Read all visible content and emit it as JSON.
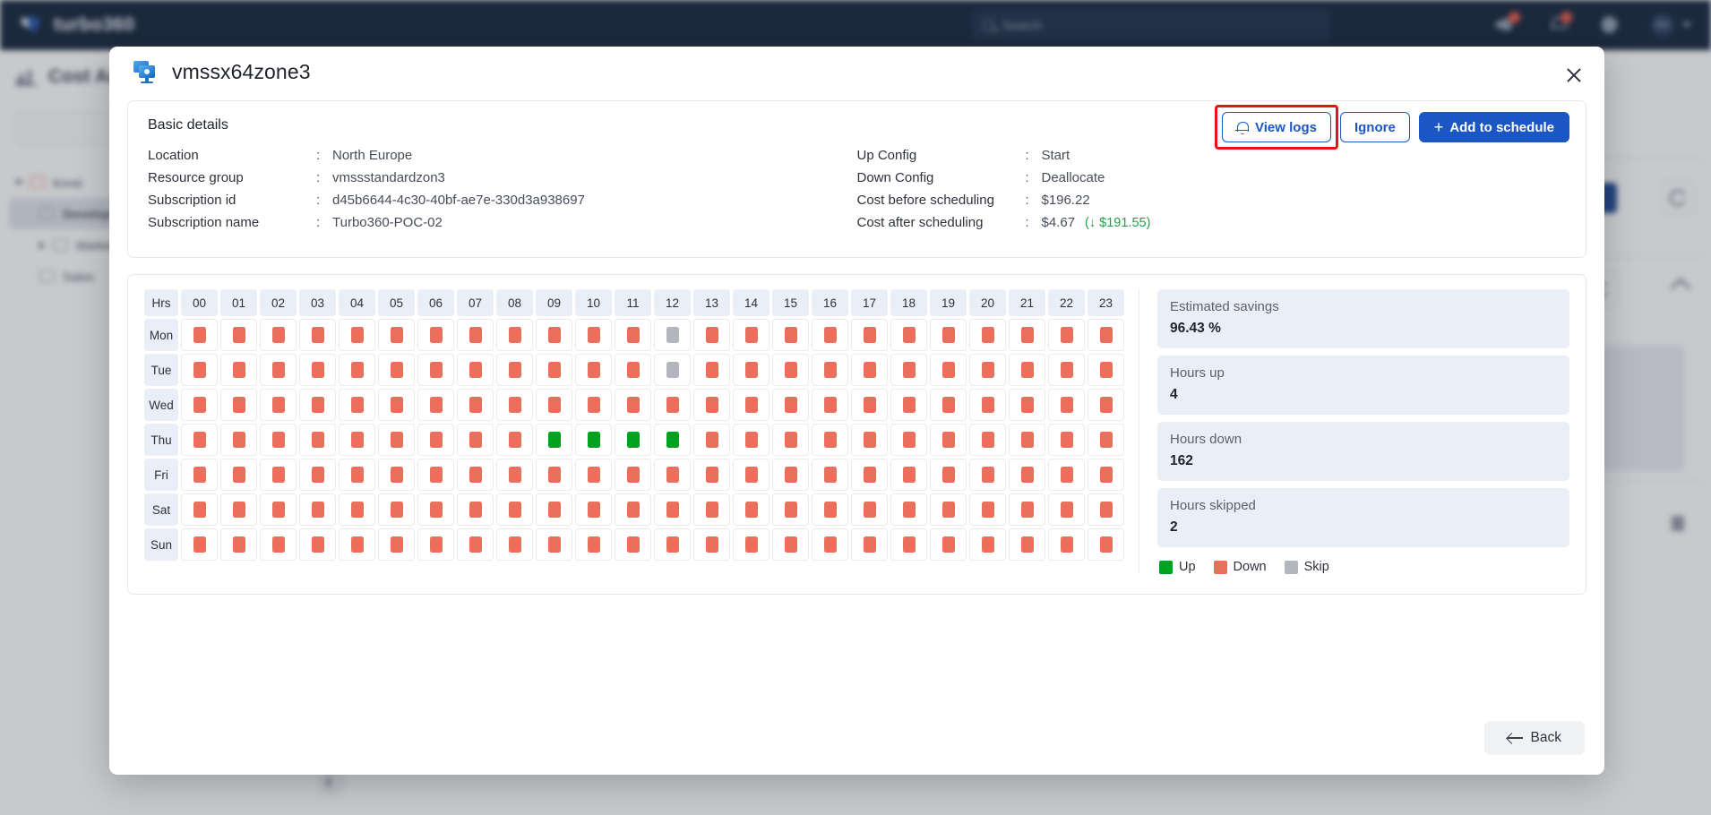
{
  "topbar": {
    "brand": "turbo360",
    "search_placeholder": "Search",
    "avatar_initials": "DV",
    "icons": [
      "megaphone-icon",
      "bell-icon",
      "gear-icon"
    ]
  },
  "background": {
    "page_title": "Cost Analysis",
    "tree": [
      {
        "label": "kovai",
        "indent": 0,
        "selected": false,
        "caret": "open",
        "folder_color": "#e8715c"
      },
      {
        "label": "Development",
        "indent": 1,
        "selected": true,
        "caret": "none",
        "folder_color": "#8d96a4"
      },
      {
        "label": "Marketing",
        "indent": 1,
        "selected": false,
        "caret": "closed",
        "folder_color": "#8d96a4"
      },
      {
        "label": "Sales",
        "indent": 1,
        "selected": false,
        "caret": "none",
        "folder_color": "#8d96a4"
      }
    ]
  },
  "modal": {
    "title": "vmssx64zone3",
    "title_icon": "vmss-icon",
    "close_icon": "close-icon",
    "basic_details_label": "Basic details",
    "separator": ":",
    "details_left": [
      {
        "key": "Location",
        "value": "North Europe"
      },
      {
        "key": "Resource group",
        "value": "vmssstandardzon3"
      },
      {
        "key": "Subscription id",
        "value": "d45b6644-4c30-40bf-ae7e-330d3a938697"
      },
      {
        "key": "Subscription name",
        "value": "Turbo360-POC-02"
      }
    ],
    "details_right": [
      {
        "key": "Up Config",
        "value": "Start"
      },
      {
        "key": "Down Config",
        "value": "Deallocate"
      },
      {
        "key": "Cost before scheduling",
        "value": "$196.22"
      },
      {
        "key": "Cost after scheduling",
        "value": "$4.67",
        "savings": "(↓ $191.55)"
      }
    ],
    "actions": {
      "view_logs": "View logs",
      "view_logs_icon": "bell-icon",
      "ignore": "Ignore",
      "add_to_schedule": "Add to schedule",
      "add_icon": "plus-icon",
      "highlight_color": "#ee1111"
    },
    "back_label": "Back",
    "back_icon": "arrow-left-icon"
  },
  "schedule": {
    "corner_label": "Hrs",
    "hours": [
      "00",
      "01",
      "02",
      "03",
      "04",
      "05",
      "06",
      "07",
      "08",
      "09",
      "10",
      "11",
      "12",
      "13",
      "14",
      "15",
      "16",
      "17",
      "18",
      "19",
      "20",
      "21",
      "22",
      "23"
    ],
    "days": [
      "Mon",
      "Tue",
      "Wed",
      "Thu",
      "Fri",
      "Sat",
      "Sun"
    ],
    "legend": [
      {
        "label": "Up",
        "color": "#00a11e",
        "state": "up"
      },
      {
        "label": "Down",
        "color": "#ea6f5c",
        "state": "down"
      },
      {
        "label": "Skip",
        "color": "#b3b7bd",
        "state": "skip"
      }
    ],
    "matrix": [
      [
        "down",
        "down",
        "down",
        "down",
        "down",
        "down",
        "down",
        "down",
        "down",
        "down",
        "down",
        "down",
        "skip",
        "down",
        "down",
        "down",
        "down",
        "down",
        "down",
        "down",
        "down",
        "down",
        "down",
        "down"
      ],
      [
        "down",
        "down",
        "down",
        "down",
        "down",
        "down",
        "down",
        "down",
        "down",
        "down",
        "down",
        "down",
        "skip",
        "down",
        "down",
        "down",
        "down",
        "down",
        "down",
        "down",
        "down",
        "down",
        "down",
        "down"
      ],
      [
        "down",
        "down",
        "down",
        "down",
        "down",
        "down",
        "down",
        "down",
        "down",
        "down",
        "down",
        "down",
        "down",
        "down",
        "down",
        "down",
        "down",
        "down",
        "down",
        "down",
        "down",
        "down",
        "down",
        "down"
      ],
      [
        "down",
        "down",
        "down",
        "down",
        "down",
        "down",
        "down",
        "down",
        "down",
        "up",
        "up",
        "up",
        "up",
        "down",
        "down",
        "down",
        "down",
        "down",
        "down",
        "down",
        "down",
        "down",
        "down",
        "down"
      ],
      [
        "down",
        "down",
        "down",
        "down",
        "down",
        "down",
        "down",
        "down",
        "down",
        "down",
        "down",
        "down",
        "down",
        "down",
        "down",
        "down",
        "down",
        "down",
        "down",
        "down",
        "down",
        "down",
        "down",
        "down"
      ],
      [
        "down",
        "down",
        "down",
        "down",
        "down",
        "down",
        "down",
        "down",
        "down",
        "down",
        "down",
        "down",
        "down",
        "down",
        "down",
        "down",
        "down",
        "down",
        "down",
        "down",
        "down",
        "down",
        "down",
        "down"
      ],
      [
        "down",
        "down",
        "down",
        "down",
        "down",
        "down",
        "down",
        "down",
        "down",
        "down",
        "down",
        "down",
        "down",
        "down",
        "down",
        "down",
        "down",
        "down",
        "down",
        "down",
        "down",
        "down",
        "down",
        "down"
      ]
    ],
    "stats": [
      {
        "key": "Estimated savings",
        "value": "96.43 %"
      },
      {
        "key": "Hours up",
        "value": "4"
      },
      {
        "key": "Hours down",
        "value": "162"
      },
      {
        "key": "Hours skipped",
        "value": "2"
      }
    ]
  }
}
